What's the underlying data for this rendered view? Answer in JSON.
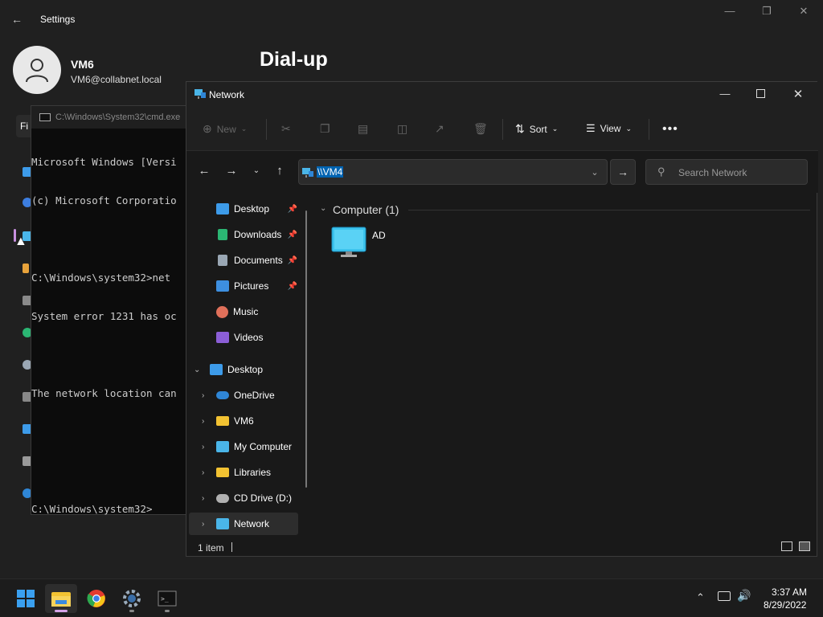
{
  "settings": {
    "title": "Settings",
    "user_name": "VM6",
    "user_email": "VM6@collabnet.local",
    "page_title": "Dial-up",
    "find_prefix": "Fi"
  },
  "cmd": {
    "title": "C:\\Windows\\System32\\cmd.exe",
    "lines": [
      "Microsoft Windows [Versi",
      "(c) Microsoft Corporatio",
      "",
      "C:\\Windows\\system32>net",
      "System error 1231 has oc",
      "",
      "The network location can",
      "",
      "",
      "C:\\Windows\\system32>"
    ]
  },
  "explorer": {
    "title": "Network",
    "toolbar": {
      "new_label": "New",
      "sort_label": "Sort",
      "view_label": "View"
    },
    "address": "\\\\VM4",
    "search_placeholder": "Search Network",
    "quick_access": [
      {
        "label": "Desktop",
        "pinned": true,
        "color": "#3d9be9"
      },
      {
        "label": "Downloads",
        "pinned": true,
        "color": "#2bb673"
      },
      {
        "label": "Documents",
        "pinned": true,
        "color": "#9aa7b4"
      },
      {
        "label": "Pictures",
        "pinned": true,
        "color": "#3d8fe0"
      },
      {
        "label": "Music",
        "pinned": false,
        "color": "#e0705a"
      },
      {
        "label": "Videos",
        "pinned": false,
        "color": "#8b5ed6"
      }
    ],
    "tree": [
      {
        "label": "Desktop",
        "expanded": true,
        "color": "#3d9be9"
      },
      {
        "label": "OneDrive",
        "color": "#2f86d6"
      },
      {
        "label": "VM6",
        "color": "#f2c232"
      },
      {
        "label": "My Computer",
        "color": "#4ab5e8"
      },
      {
        "label": "Libraries",
        "color": "#f2c232"
      },
      {
        "label": "CD Drive (D:)",
        "color": "#b0b0b0"
      },
      {
        "label": "Network",
        "selected": true,
        "color": "#4ab5e8"
      }
    ],
    "group_header": "Computer (1)",
    "items": [
      {
        "label": "AD"
      }
    ],
    "status": "1 item"
  },
  "taskbar": {
    "time": "3:37 AM",
    "date": "8/29/2022"
  }
}
